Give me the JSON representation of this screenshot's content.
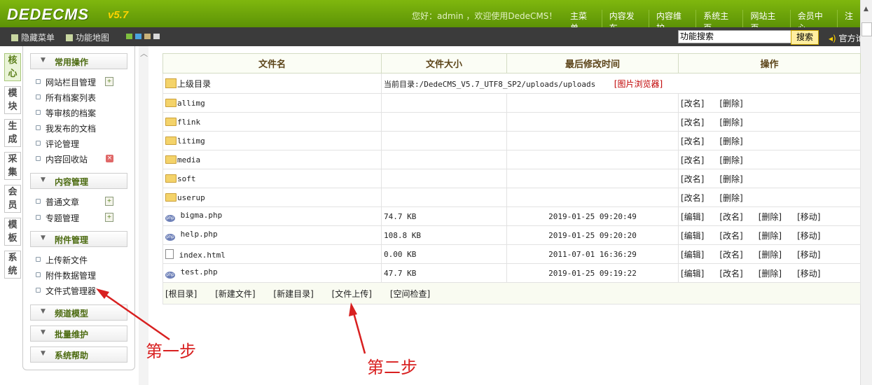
{
  "header": {
    "logo": "DEDECMS",
    "logo_version": "v5.7",
    "welcome": "您好：admin ，欢迎使用DedeCMS！",
    "nav": [
      "主菜单",
      "内容发布",
      "内容维护",
      "系统主页",
      "网站主页",
      "会员中心",
      "注"
    ]
  },
  "toolbar": {
    "hide_menu": "隐藏菜单",
    "function_map": "功能地图",
    "skin_colors": [
      "#7fbf3f",
      "#4aa3df",
      "#c9b27a",
      "#d9d9d9"
    ],
    "search_value": "功能搜索",
    "search_button": "搜索",
    "official": "官方论"
  },
  "vtabs": [
    {
      "label": "核心",
      "active": true
    },
    {
      "label": "模块",
      "active": false
    },
    {
      "label": "生成",
      "active": false
    },
    {
      "label": "采集",
      "active": false
    },
    {
      "label": "会员",
      "active": false
    },
    {
      "label": "模板",
      "active": false
    },
    {
      "label": "系统",
      "active": false
    }
  ],
  "menu": {
    "sections": [
      {
        "title": "常用操作",
        "items": [
          "网站栏目管理",
          "所有档案列表",
          "等审核的档案",
          "我发布的文档",
          "评论管理",
          "内容回收站"
        ]
      },
      {
        "title": "内容管理",
        "items": [
          "普通文章",
          "专题管理"
        ]
      },
      {
        "title": "附件管理",
        "items": [
          "上传新文件",
          "附件数据管理",
          "文件式管理器"
        ]
      },
      {
        "title": "频道模型",
        "items": []
      },
      {
        "title": "批量维护",
        "items": []
      },
      {
        "title": "系统帮助",
        "items": []
      }
    ]
  },
  "table": {
    "headers": [
      "文件名",
      "文件大小",
      "最后修改时间",
      "操作"
    ],
    "parent_label": "上级目录",
    "current_dir": "当前目录:/DedeCMS_V5.7_UTF8_SP2/uploads/uploads",
    "image_browser": "[图片浏览器]",
    "folders": [
      "allimg",
      "flink",
      "litimg",
      "media",
      "soft",
      "userup"
    ],
    "files": [
      {
        "name": "bigma.php",
        "size": "74.7 KB",
        "time": "2019-01-25 09:20:49",
        "type": "php"
      },
      {
        "name": "help.php",
        "size": "108.8 KB",
        "time": "2019-01-25 09:20:20",
        "type": "php"
      },
      {
        "name": "index.html",
        "size": "0.00 KB",
        "time": "2011-07-01 16:36:29",
        "type": "html"
      },
      {
        "name": "test.php",
        "size": "47.7 KB",
        "time": "2019-01-25 09:19:22",
        "type": "php"
      }
    ],
    "actions": {
      "edit": "[编辑]",
      "rename": "[改名]",
      "delete": "[删除]",
      "move": "[移动]"
    },
    "bottom": [
      "[根目录]",
      "[新建文件]",
      "[新建目录]",
      "[文件上传]",
      "[空间检查]"
    ]
  },
  "annotations": {
    "step1": "第一步",
    "step2": "第二步",
    "color": "#d82020"
  }
}
